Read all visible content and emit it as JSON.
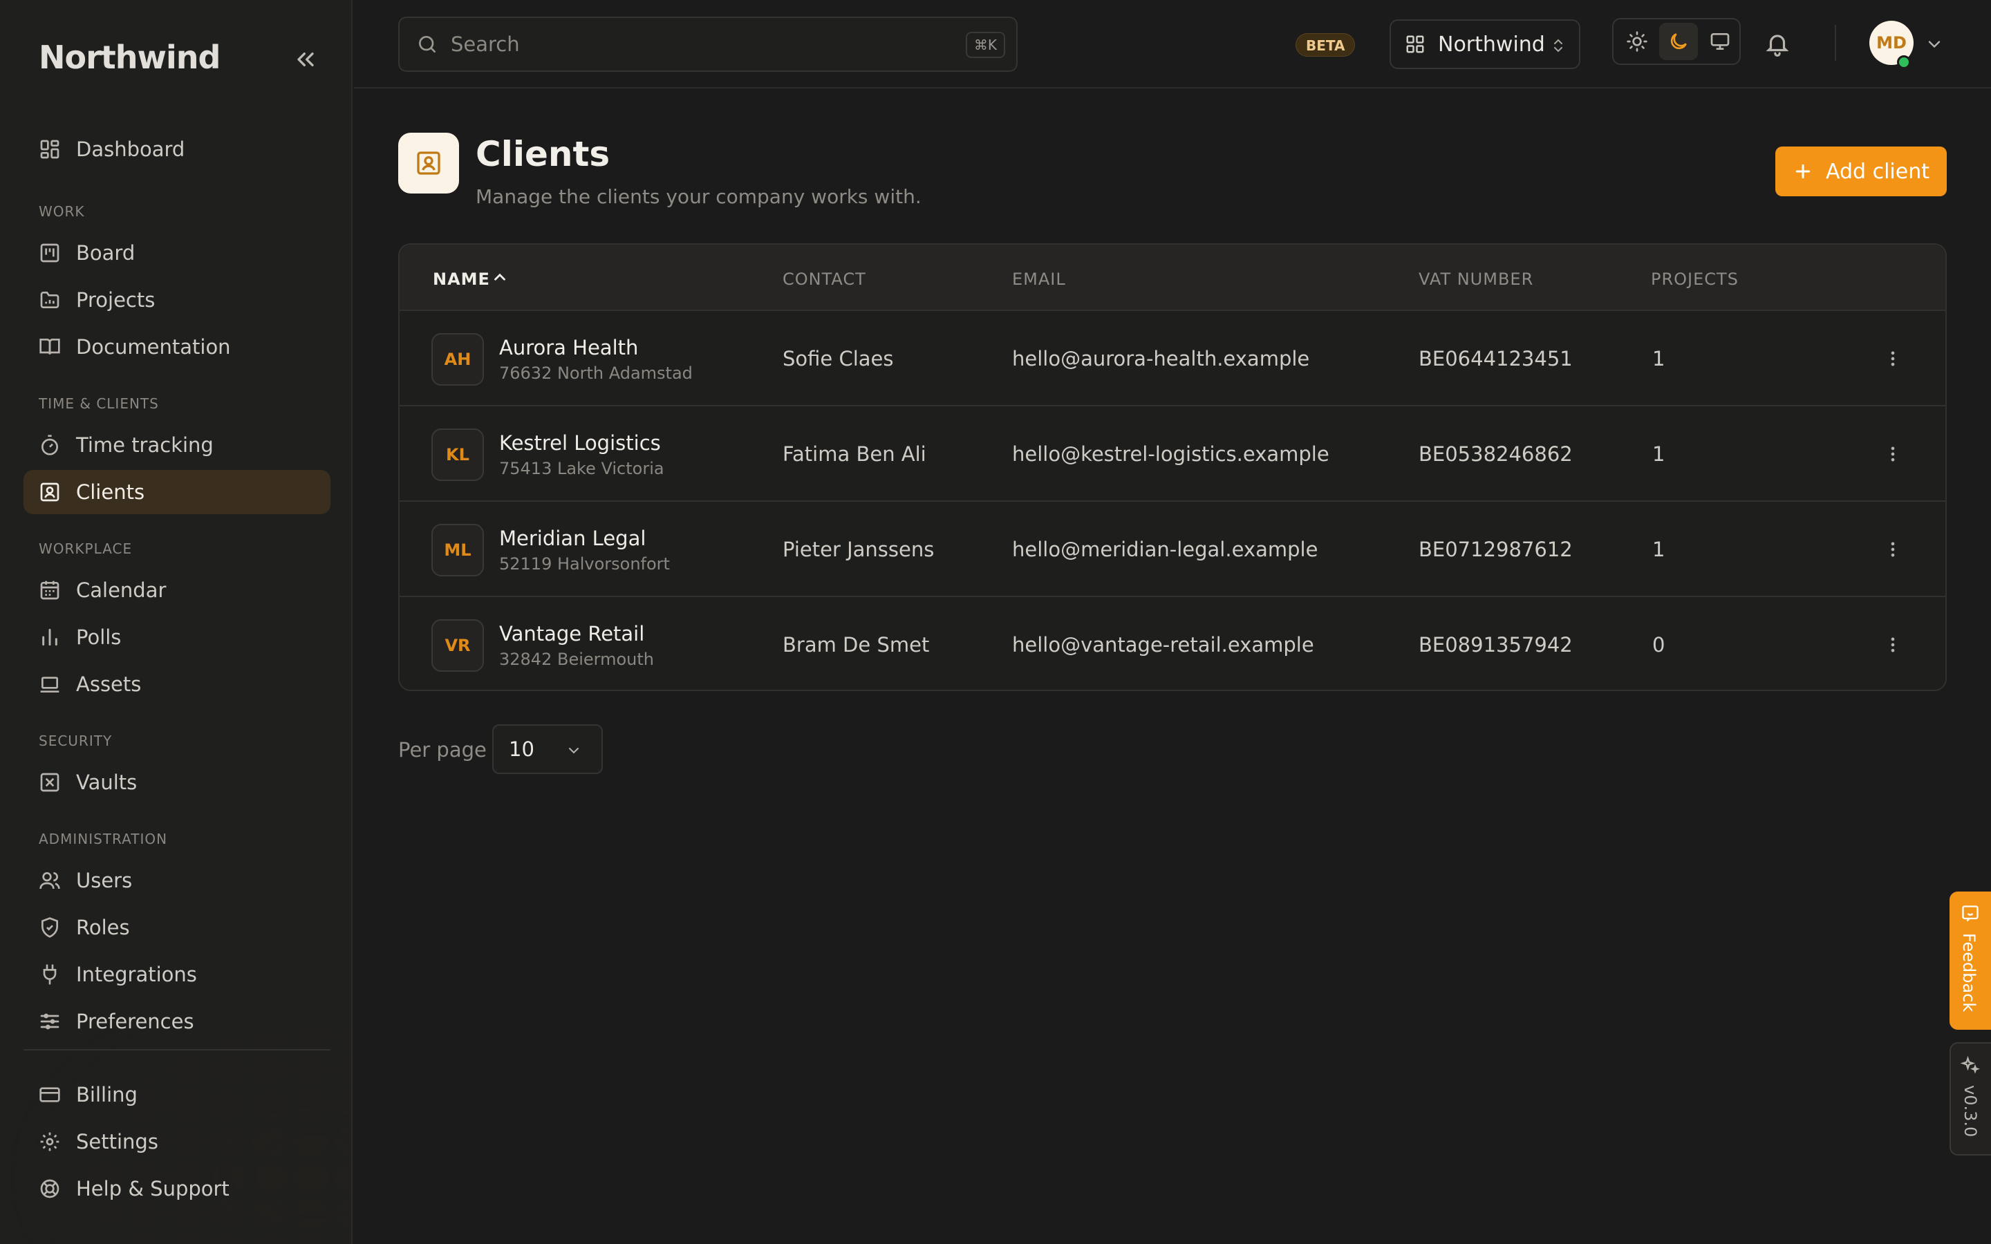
{
  "app": {
    "brand": "Northwind"
  },
  "sidebar": {
    "dashboard": {
      "label": "Dashboard",
      "icon": "dashboard-icon"
    },
    "sections": {
      "work": "WORK",
      "time_clients": "TIME & CLIENTS",
      "workplace": "WORKPLACE",
      "security": "SECURITY",
      "administration": "ADMINISTRATION"
    },
    "items": {
      "board": "Board",
      "projects": "Projects",
      "documentation": "Documentation",
      "time_tracking": "Time tracking",
      "clients": "Clients",
      "calendar": "Calendar",
      "polls": "Polls",
      "assets": "Assets",
      "vaults": "Vaults",
      "users": "Users",
      "roles": "Roles",
      "integrations": "Integrations",
      "preferences": "Preferences",
      "billing": "Billing",
      "settings": "Settings",
      "help": "Help & Support"
    },
    "active": "clients"
  },
  "topbar": {
    "search_placeholder": "Search",
    "search_shortcut": "⌘K",
    "beta_badge": "BETA",
    "workspace": "Northwind",
    "theme": "dark",
    "user_initials": "MD",
    "user_status": "online"
  },
  "page": {
    "title": "Clients",
    "subtitle": "Manage the clients your company works with.",
    "add_button": "Add client"
  },
  "table": {
    "columns": {
      "name": "NAME",
      "contact": "CONTACT",
      "email": "EMAIL",
      "vat": "VAT NUMBER",
      "projects": "PROJECTS"
    },
    "sort": {
      "column": "name",
      "direction": "asc"
    },
    "rows": [
      {
        "initials": "AH",
        "name": "Aurora Health",
        "address": "76632 North Adamstad",
        "contact": "Sofie Claes",
        "email": "hello@aurora-health.example",
        "vat": "BE0644123451",
        "projects": "1"
      },
      {
        "initials": "KL",
        "name": "Kestrel Logistics",
        "address": "75413 Lake Victoria",
        "contact": "Fatima Ben Ali",
        "email": "hello@kestrel-logistics.example",
        "vat": "BE0538246862",
        "projects": "1"
      },
      {
        "initials": "ML",
        "name": "Meridian Legal",
        "address": "52119 Halvorsonfort",
        "contact": "Pieter Janssens",
        "email": "hello@meridian-legal.example",
        "vat": "BE0712987612",
        "projects": "1"
      },
      {
        "initials": "VR",
        "name": "Vantage Retail",
        "address": "32842 Beiermouth",
        "contact": "Bram De Smet",
        "email": "hello@vantage-retail.example",
        "vat": "BE0891357942",
        "projects": "0"
      }
    ]
  },
  "pagination": {
    "per_page_label": "Per page",
    "per_page_value": "10"
  },
  "side_tabs": {
    "feedback": "Feedback",
    "version": "v0.3.0"
  },
  "colors": {
    "accent": "#f39416",
    "background": "#1b1b1b",
    "sidebar": "#1f1f1e",
    "active_nav": "#3a2f1f"
  }
}
